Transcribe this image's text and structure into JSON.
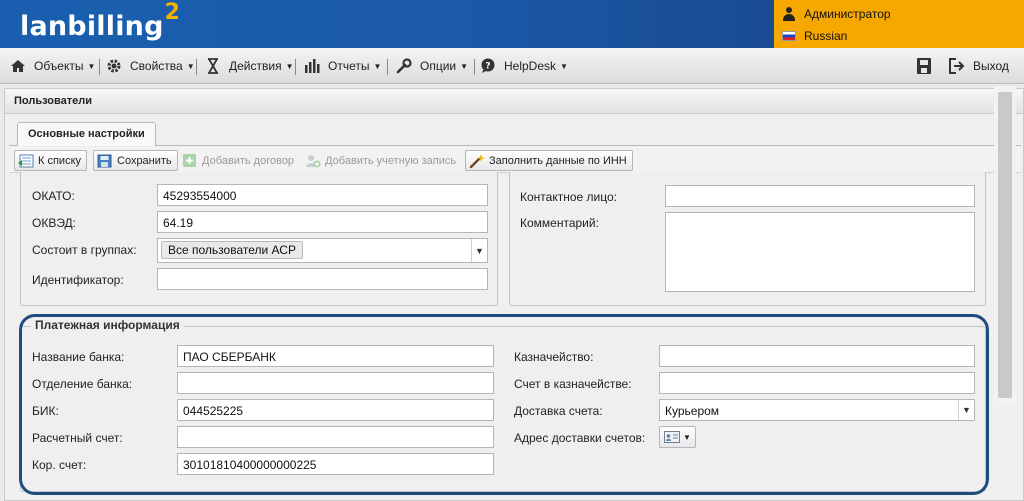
{
  "header": {
    "logo_text": "lanbilling",
    "logo_superscript": "2",
    "user_name": "Администратор",
    "language": "Russian"
  },
  "menu": {
    "objects": "Объекты",
    "properties": "Свойства",
    "actions": "Действия",
    "reports": "Отчеты",
    "options": "Опции",
    "helpdesk": "HelpDesk",
    "logout": "Выход"
  },
  "window": {
    "title": "Пользователи",
    "tab": "Основные настройки"
  },
  "toolbar": {
    "to_list": "К списку",
    "save": "Сохранить",
    "add_contract": "Добавить договор",
    "add_account": "Добавить учетную запись",
    "fill_by_inn": "Заполнить данные по ИНН"
  },
  "form": {
    "okato_label": "ОКАТО:",
    "okato_value": "45293554000",
    "okved_label": "ОКВЭД:",
    "okved_value": "64.19",
    "groups_label": "Состоит в группах:",
    "groups_value": "Все пользователи АСР",
    "identifier_label": "Идентификатор:",
    "identifier_value": "",
    "contact_label": "Контактное лицо:",
    "contact_value": "",
    "comment_label": "Комментарий:",
    "comment_value": ""
  },
  "payment": {
    "legend": "Платежная информация",
    "bank_name_label": "Название банка:",
    "bank_name_value": "ПАО СБЕРБАНК",
    "bank_branch_label": "Отделение банка:",
    "bank_branch_value": "",
    "bik_label": "БИК:",
    "bik_value": "044525225",
    "settlement_label": "Расчетный счет:",
    "settlement_value": "",
    "corr_label": "Кор. счет:",
    "corr_value": "30101810400000000225",
    "treasury_label": "Казначейство:",
    "treasury_value": "",
    "treasury_account_label": "Счет в казначействе:",
    "treasury_account_value": "",
    "delivery_label": "Доставка счета:",
    "delivery_value": "Курьером",
    "delivery_address_label": "Адрес доставки счетов:"
  }
}
